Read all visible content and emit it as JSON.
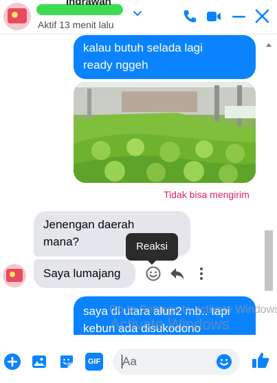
{
  "header": {
    "contact_name": "Indrawan",
    "status": "Aktif 13 menit lalu"
  },
  "messages": {
    "out1_line1": "kalau butuh selada lagi",
    "out1_line2": "ready nggeh",
    "failed_label": "Tidak bisa mengirim",
    "in1_line1": "Jenengan daerah",
    "in1_line2": "mana?",
    "in2": "Saya lumajang",
    "out2_line1": "saya di utara alun2 mb.. tapi",
    "out2_line2": "kebun ada disukodono"
  },
  "tooltip": {
    "label": "Reaksi"
  },
  "composer": {
    "placeholder": "Aa",
    "gif_label": "GIF"
  },
  "watermark": {
    "title": "Activate Windows",
    "subtitle": "Go to Settings to activate Windows."
  },
  "colors": {
    "accent": "#0b83ff",
    "incoming_bubble": "#e4e6eb",
    "error": "#e0245e",
    "tooltip_bg": "#2b2b2b"
  },
  "icons": [
    "chevron-down-icon",
    "phone-icon",
    "video-icon",
    "minimize-icon",
    "close-icon",
    "smile-icon",
    "reply-icon",
    "more-icon",
    "plus-icon",
    "image-icon",
    "sticker-icon",
    "gif-icon",
    "emoji-icon",
    "like-icon"
  ]
}
